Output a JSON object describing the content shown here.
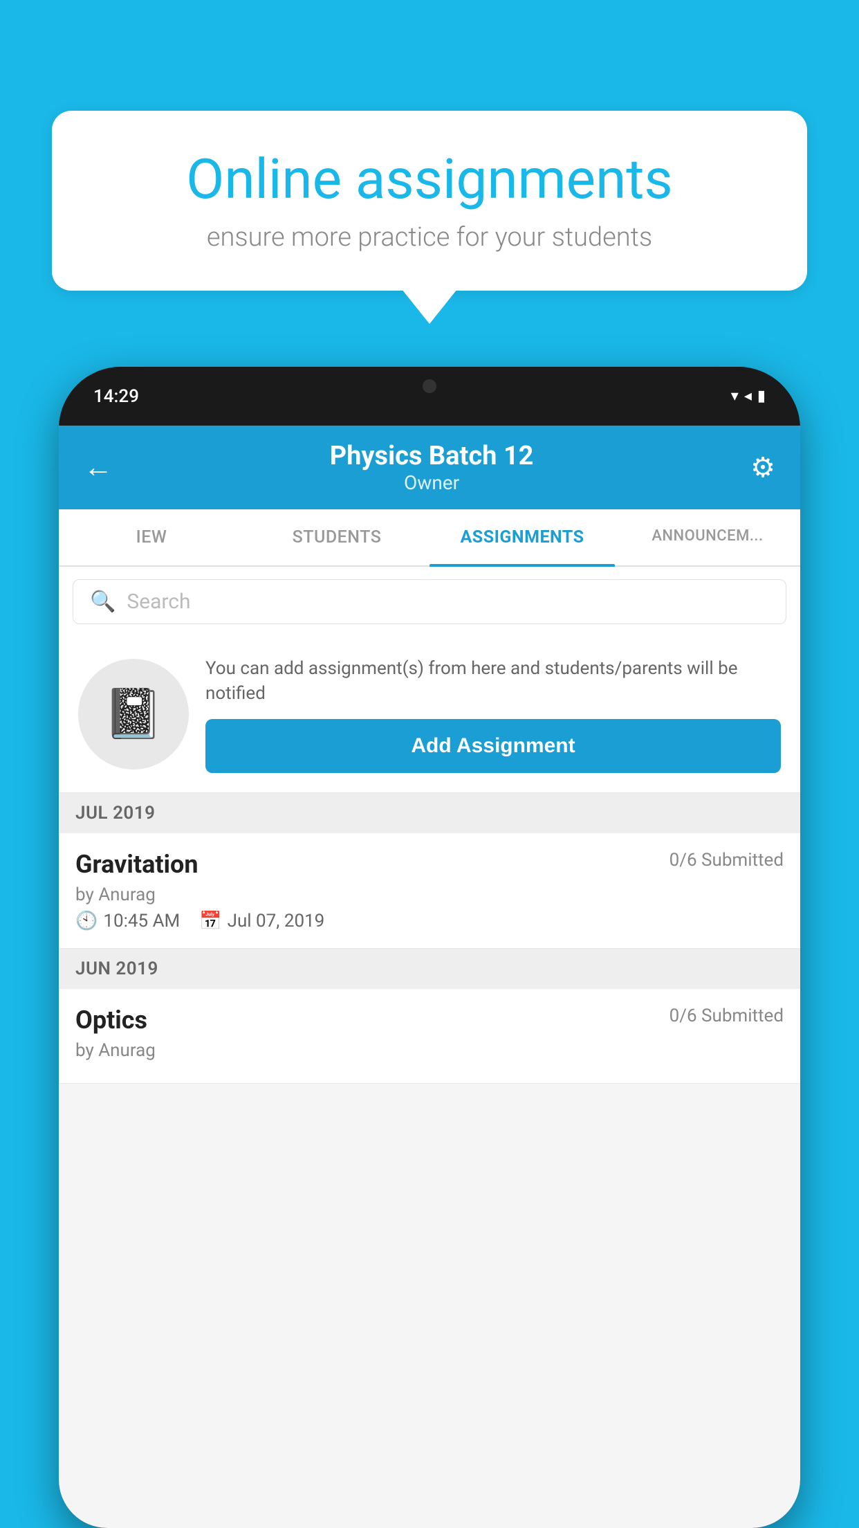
{
  "background_color": "#1ab8e8",
  "speech_bubble": {
    "title": "Online assignments",
    "subtitle": "ensure more practice for your students"
  },
  "phone": {
    "status_bar": {
      "time": "14:29",
      "icons": "▾◂▮"
    },
    "header": {
      "title": "Physics Batch 12",
      "subtitle": "Owner",
      "back_label": "←",
      "settings_label": "⚙"
    },
    "tabs": [
      {
        "label": "IEW",
        "active": false
      },
      {
        "label": "STUDENTS",
        "active": false
      },
      {
        "label": "ASSIGNMENTS",
        "active": true
      },
      {
        "label": "ANNOUNCEM...",
        "active": false
      }
    ],
    "search": {
      "placeholder": "Search"
    },
    "promo": {
      "description": "You can add assignment(s) from here and students/parents will be notified",
      "add_button_label": "Add Assignment"
    },
    "sections": [
      {
        "month_label": "JUL 2019",
        "assignments": [
          {
            "title": "Gravitation",
            "submitted": "0/6 Submitted",
            "by": "by Anurag",
            "time": "10:45 AM",
            "date": "Jul 07, 2019"
          }
        ]
      },
      {
        "month_label": "JUN 2019",
        "assignments": [
          {
            "title": "Optics",
            "submitted": "0/6 Submitted",
            "by": "by Anurag",
            "time": "",
            "date": ""
          }
        ]
      }
    ]
  }
}
